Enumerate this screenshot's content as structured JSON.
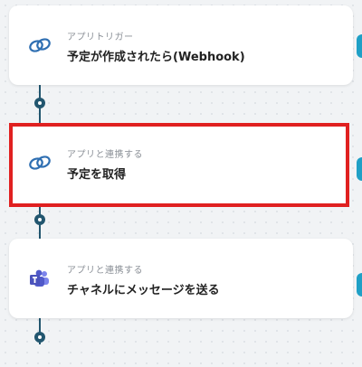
{
  "flow": {
    "steps": [
      {
        "kind": "アプリトリガー",
        "title": "予定が作成されたら(Webhook)",
        "icon": "chain-link-icon"
      },
      {
        "kind": "アプリと連携する",
        "title": "予定を取得",
        "icon": "chain-link-icon",
        "selected": true
      },
      {
        "kind": "アプリと連携する",
        "title": "チャネルにメッセージを送る",
        "icon": "teams-icon"
      }
    ]
  },
  "colors": {
    "connector": "#22566f",
    "highlight": "#e02020",
    "link_icon": "#2f6fb2",
    "teams": "#5059c9",
    "edge_tab": "#1fa0c6"
  }
}
